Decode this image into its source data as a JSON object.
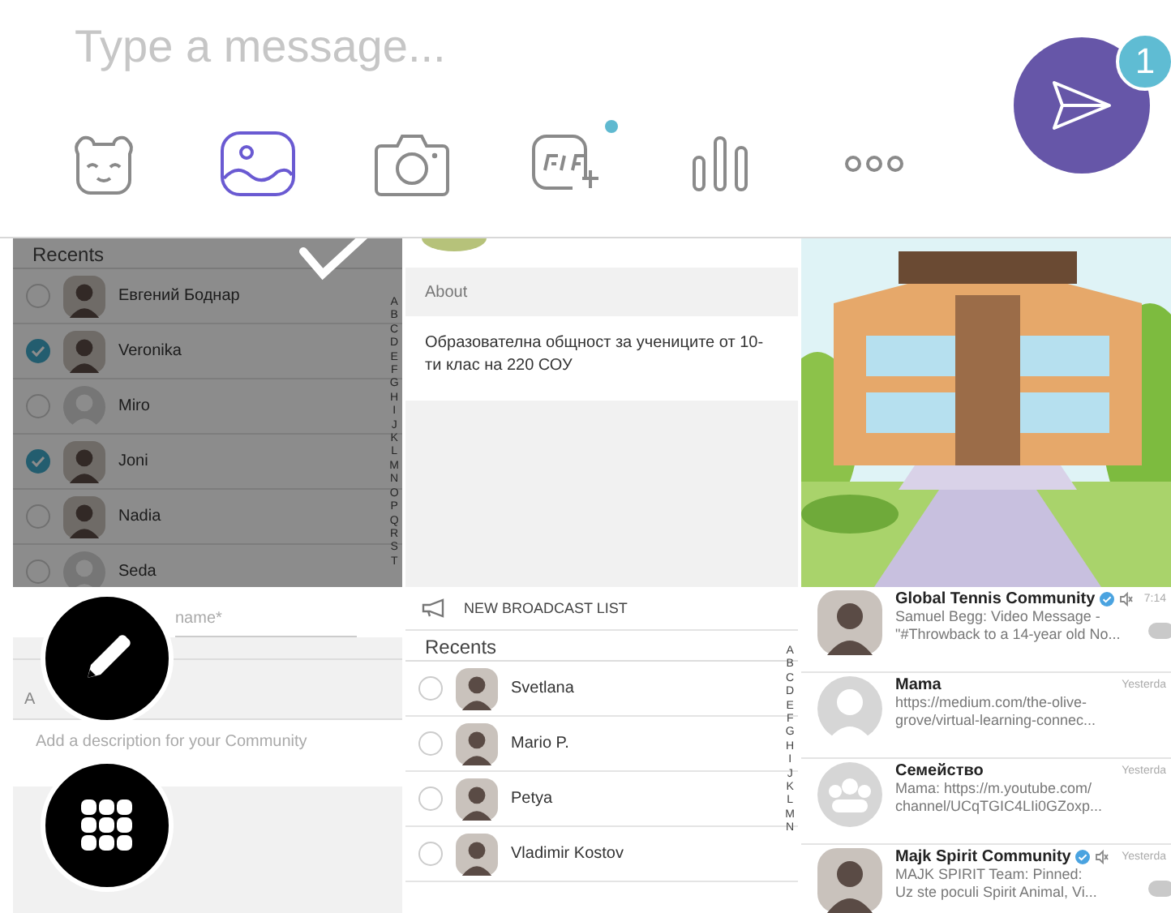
{
  "composer": {
    "placeholder": "Type a message...",
    "send_badge": "1"
  },
  "toolbar": [
    {
      "kind": "sticker",
      "selected": false,
      "new": false
    },
    {
      "kind": "gallery",
      "selected": true,
      "new": false
    },
    {
      "kind": "camera",
      "selected": false,
      "new": false
    },
    {
      "kind": "gif",
      "selected": false,
      "new": true
    },
    {
      "kind": "poll",
      "selected": false,
      "new": false
    },
    {
      "kind": "more",
      "selected": false,
      "new": false
    }
  ],
  "gallery": [
    {
      "kind": "contacts",
      "selected": true,
      "header": "Recents",
      "index": [
        "A",
        "B",
        "C",
        "D",
        "E",
        "F",
        "G",
        "H",
        "I",
        "J",
        "K",
        "L",
        "M",
        "N",
        "O",
        "P",
        "Q",
        "R",
        "S",
        "T"
      ],
      "contacts": [
        {
          "name": "Евгений Боднар",
          "checked": false
        },
        {
          "name": "Veronika",
          "checked": true
        },
        {
          "name": "Miro",
          "checked": false,
          "kind": "placeholder"
        },
        {
          "name": "Joni",
          "checked": true
        },
        {
          "name": "Nadia",
          "checked": false
        },
        {
          "name": "Seda",
          "checked": false,
          "kind": "placeholder"
        }
      ]
    },
    {
      "kind": "about",
      "selected": false,
      "header": "About",
      "text": "Образователна общност за учениците от 10-ти клас на 220 СОУ"
    },
    {
      "kind": "picture",
      "selected": false
    },
    {
      "kind": "form",
      "selected": false,
      "name_placeholder": "name*",
      "section": "A",
      "description_placeholder": "Add a description for your Community"
    },
    {
      "kind": "contacts",
      "selected": false,
      "action": "NEW BROADCAST LIST",
      "header": "Recents",
      "index": [
        "A",
        "B",
        "C",
        "D",
        "E",
        "F",
        "G",
        "H",
        "I",
        "J",
        "K",
        "L",
        "M",
        "N"
      ],
      "contacts": [
        {
          "name": "Svetlana",
          "checked": false
        },
        {
          "name": "Mario P.",
          "checked": false
        },
        {
          "name": "Petya",
          "checked": false
        },
        {
          "name": "Vladimir Kostov",
          "checked": false
        }
      ]
    },
    {
      "kind": "chats",
      "selected": false,
      "chats": [
        {
          "title": "Global Tennis Community",
          "time": "7:14",
          "verified": true,
          "muted": true,
          "unread": true,
          "preview": "Samuel Begg: Video Message -\n\"#Throwback to a 14-year old No..."
        },
        {
          "title": "Mama",
          "time": "Yesterda",
          "verified": false,
          "muted": false,
          "unread": false,
          "kind": "placeholder",
          "preview": "https://medium.com/the-olive-\ngrove/virtual-learning-connec..."
        },
        {
          "title": "Семейство",
          "time": "Yesterda",
          "verified": false,
          "muted": false,
          "unread": false,
          "kind": "group",
          "preview": "Mama: https://m.youtube.com/\nchannel/UCqTGIC4LIi0GZoxp..."
        },
        {
          "title": "Majk Spirit Community",
          "time": "Yesterda",
          "verified": true,
          "muted": true,
          "unread": true,
          "preview": "MAJK SPIRIT Team: Pinned:\nUz ste poculi Spirit Animal, Vi..."
        }
      ]
    }
  ]
}
